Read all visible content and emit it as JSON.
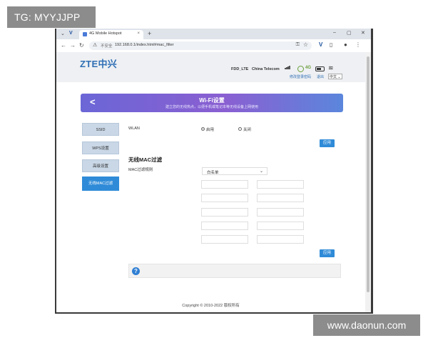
{
  "watermark_top": "TG: MYYJJPP",
  "watermark_bottom": "www.daonun.com",
  "browser": {
    "tab_title": "4G Mobile Hotspot",
    "tab_close": "×",
    "new_tab": "+",
    "insecure_label": "不安全",
    "url": "192.168.0.1/index.html#mac_filter",
    "window_controls": [
      "–",
      "▢",
      "✕"
    ]
  },
  "header": {
    "logo": "ZTE中兴",
    "device": "FDD_LTE",
    "carrier": "China Telecom",
    "network_label": "4G",
    "link_change_password": "修改登录密码",
    "link_logout": "退出",
    "language": "中文"
  },
  "banner": {
    "back": "<",
    "title": "Wi-Fi设置",
    "subtitle": "建立您的无线热点，以便手机或笔记本等无线设备上网使用"
  },
  "sidebar": {
    "items": [
      {
        "label": "SSID"
      },
      {
        "label": "WPS设置"
      },
      {
        "label": "高级设置"
      },
      {
        "label": "无线MAC过滤"
      }
    ]
  },
  "wlan": {
    "label": "WLAN",
    "option_on": "启用",
    "option_off": "关闭",
    "apply": "应用"
  },
  "mac_filter": {
    "section_title": "无线MAC过滤",
    "rule_label": "MAC过滤规则",
    "rule_value": "白名单",
    "apply": "应用"
  },
  "help_icon": "?",
  "footer": "Copyright © 2010-2022 版权所有"
}
